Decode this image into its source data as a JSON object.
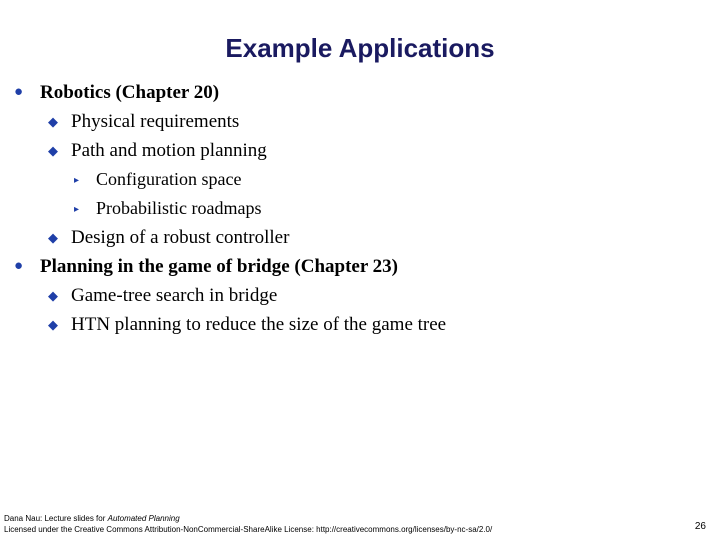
{
  "slide": {
    "title": "Example Applications",
    "page_number": "26",
    "title_color": "#1a1a60",
    "bullet_color": "#1f3fa8",
    "text_color": "#000000",
    "background_color": "#ffffff"
  },
  "bullets": [
    {
      "level": 1,
      "marker": "circle",
      "text": "Robotics (Chapter 20)",
      "bold": true
    },
    {
      "level": 2,
      "marker": "diamond",
      "text": "Physical requirements",
      "bold": false
    },
    {
      "level": 2,
      "marker": "diamond",
      "text": "Path and motion planning",
      "bold": false
    },
    {
      "level": 3,
      "marker": "triangle",
      "text": "Configuration space",
      "bold": false
    },
    {
      "level": 3,
      "marker": "triangle",
      "text": "Probabilistic roadmaps",
      "bold": false
    },
    {
      "level": 2,
      "marker": "diamond",
      "text": "Design of a robust controller",
      "bold": false
    },
    {
      "level": 1,
      "marker": "circle",
      "text": "Planning in the game of bridge (Chapter 23)",
      "bold": true
    },
    {
      "level": 2,
      "marker": "diamond",
      "text": "Game-tree search in bridge",
      "bold": false
    },
    {
      "level": 2,
      "marker": "diamond",
      "text": "HTN planning to reduce the size of the game tree",
      "bold": false
    }
  ],
  "markers": {
    "circle": "●",
    "diamond": "◆",
    "triangle": "▸"
  },
  "footer": {
    "line1_prefix": "Dana Nau: Lecture slides for ",
    "line1_work": "Automated Planning",
    "line2": "Licensed under the Creative Commons Attribution-NonCommercial-ShareAlike License: http://creativecommons.org/licenses/by-nc-sa/2.0/"
  }
}
